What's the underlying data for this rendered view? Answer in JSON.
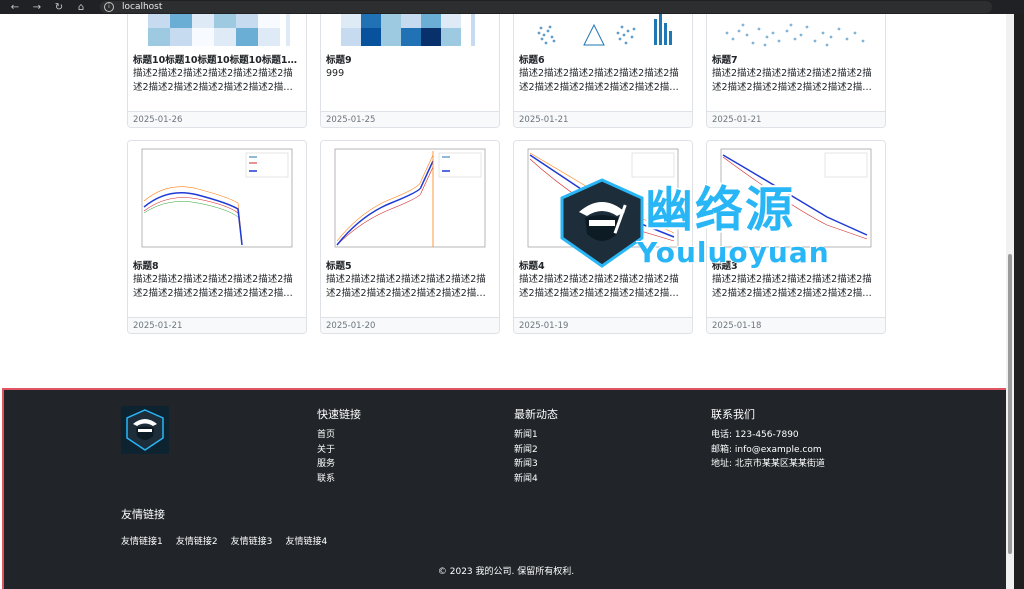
{
  "browser": {
    "url": "localhost",
    "icons": [
      "back-arrow-icon",
      "forward-arrow-icon",
      "reload-icon",
      "home-icon",
      "info-icon"
    ]
  },
  "cards": [
    {
      "title": "标题10标题10标题10标题10标题10...",
      "desc": "描述2描述2描述2描述2描述2描述2描述2描述2描述2描述2描述2描述2描述2...",
      "date": "2025-01-26"
    },
    {
      "title": "标题9",
      "desc": "999",
      "date": "2025-01-25"
    },
    {
      "title": "标题6",
      "desc": "描述2描述2描述2描述2描述2描述2描述2描述2描述2描述2描述2描述2描述2...",
      "date": "2025-01-21"
    },
    {
      "title": "标题7",
      "desc": "描述2描述2描述2描述2描述2描述2描述2描述2描述2描述2描述2描述2描述2...",
      "date": "2025-01-21"
    },
    {
      "title": "标题8",
      "desc": "描述2描述2描述2描述2描述2描述2描述2描述2描述2描述2描述2描述2描述2...",
      "date": "2025-01-21"
    },
    {
      "title": "标题5",
      "desc": "描述2描述2描述2描述2描述2描述2描述2描述2描述2描述2描述2描述2描述2...",
      "date": "2025-01-20"
    },
    {
      "title": "标题4",
      "desc": "描述2描述2描述2描述2描述2描述2描述2描述2描述2描述2描述2描述2描述2...",
      "date": "2025-01-19"
    },
    {
      "title": "标题3",
      "desc": "描述2描述2描述2描述2描述2描述2描述2描述2描述2描述2描述2描述2描述2...",
      "date": "2025-01-18"
    }
  ],
  "footer": {
    "quick_links": {
      "heading": "快速链接",
      "items": [
        "首页",
        "关于",
        "服务",
        "联系"
      ]
    },
    "news": {
      "heading": "最新动态",
      "items": [
        "新闻1",
        "新闻2",
        "新闻3",
        "新闻4"
      ]
    },
    "contact": {
      "heading": "联系我们",
      "phone": "电话: 123-456-7890",
      "email": "邮箱: info@example.com",
      "address": "地址: 北京市某某区某某街道"
    },
    "friends": {
      "heading": "友情链接",
      "items": [
        "友情链接1",
        "友情链接2",
        "友情链接3",
        "友情链接4"
      ]
    },
    "copyright": "© 2023 我的公司. 保留所有权利."
  },
  "watermark": {
    "cn": "幽络源",
    "en": "Youluoyuan"
  },
  "colors": {
    "footer_bg": "#212529",
    "highlight_border": "#e05561",
    "watermark": "#29b6f6",
    "accent_blue": "#1f3bd6"
  }
}
